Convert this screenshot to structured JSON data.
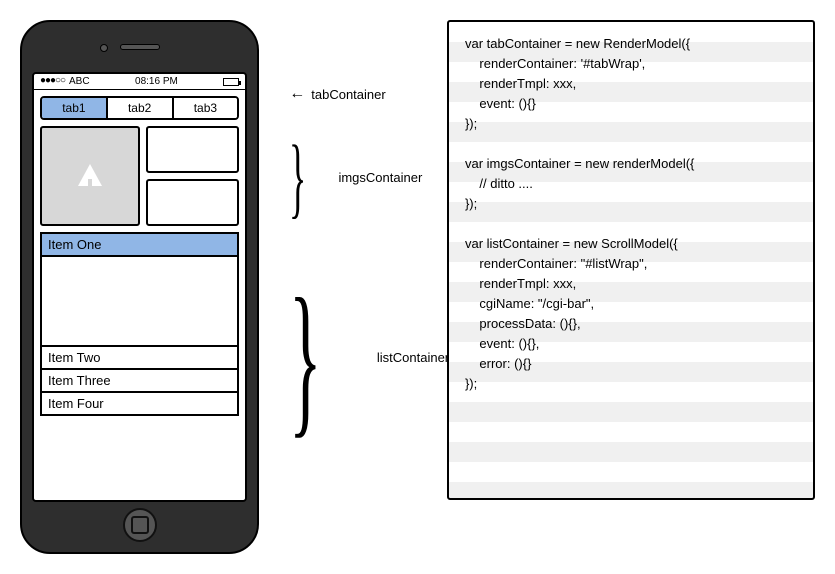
{
  "statusbar": {
    "signal": "●●●○○",
    "carrier": "ABC",
    "time": "08:16 PM"
  },
  "tabs": [
    {
      "label": "tab1",
      "active": true
    },
    {
      "label": "tab2",
      "active": false
    },
    {
      "label": "tab3",
      "active": false
    }
  ],
  "list_items": [
    {
      "label": "Item One",
      "active": true
    },
    {
      "label": "Item Two",
      "active": false
    },
    {
      "label": "Item Three",
      "active": false
    },
    {
      "label": "Item Four",
      "active": false
    }
  ],
  "annotations": {
    "tab": "tabContainer",
    "imgs": "imgsContainer",
    "list": "listContainer"
  },
  "code_lines": [
    "var tabContainer = new RenderModel({",
    "    renderContainer: '#tabWrap',",
    "    renderTmpl: xxx,",
    "    event: (){}",
    "});",
    "",
    "var imgsContainer = new renderModel({",
    "    // ditto ....",
    "});",
    "",
    "var listContainer = new ScrollModel({",
    "    renderContainer: \"#listWrap\",",
    "    renderTmpl: xxx,",
    "    cgiName: \"/cgi-bar\",",
    "    processData: (){},",
    "    event: (){},",
    "    error: (){}",
    "});"
  ]
}
